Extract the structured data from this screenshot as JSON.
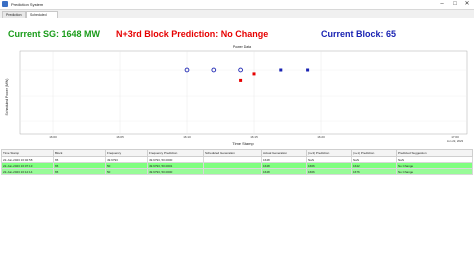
{
  "window": {
    "title": "Prediction System",
    "minimize": "–",
    "maximize": "□",
    "close": "✕"
  },
  "tabs": [
    {
      "label": "Prediction"
    },
    {
      "label": "Scheduled Power"
    }
  ],
  "header": {
    "current_sg": "Current SG: 1648 MW",
    "prediction": "N+3rd Block Prediction: No Change",
    "current_block": "Current Block: 65",
    "colors": {
      "current_sg": "#1a9c1a",
      "prediction": "#e60000",
      "current_block": "#1a23b3"
    }
  },
  "chart_data": {
    "type": "scatter",
    "title": "Power Data",
    "xlabel": "Time Stamp",
    "ylabel": "Scheduled Power (MW)",
    "x_ticks": [
      "16:00",
      "16:05",
      "16:10",
      "16:15",
      "16:20"
    ],
    "x_tick_last": "17:00",
    "x_tick_last_date": "Jun 22, 2023",
    "grid": true,
    "series": [
      {
        "marker": "open-circle",
        "color": "#1a23b3",
        "points": [
          {
            "x": "16:10",
            "y": 1648
          },
          {
            "x": "16:12",
            "y": 1648
          },
          {
            "x": "16:14",
            "y": 1648
          }
        ]
      },
      {
        "marker": "filled-square",
        "color": "#e60000",
        "points": [
          {
            "x": "16:14",
            "y": 1640
          },
          {
            "x": "16:15",
            "y": 1645
          }
        ]
      },
      {
        "marker": "filled-square",
        "color": "#1a23b3",
        "points": [
          {
            "x": "16:17",
            "y": 1648
          },
          {
            "x": "16:19",
            "y": 1648
          }
        ]
      }
    ]
  },
  "table": {
    "columns": [
      "Time Stamp",
      "Block",
      "Frequency",
      "Frequency Prediction",
      "Scheduled Generation",
      "Actual Generation",
      "(n+3) Prediction",
      "(n+1) Prediction",
      "Predicted Suggestion"
    ],
    "rows": [
      {
        "cells": [
          "22-Jun-2023 16:02:58",
          "65",
          "49.9793",
          "49.9793, 50.0000",
          "",
          "1648",
          "NaN",
          "NaN",
          "NaN"
        ],
        "style": "plain"
      },
      {
        "cells": [
          "22-Jun-2023 16:07:13",
          "65",
          "50",
          "49.9793, 50.0001",
          "",
          "1648",
          "1666",
          "1642",
          "No Change"
        ],
        "style": "sel"
      },
      {
        "cells": [
          "22-Jun-2023 16:12:14",
          "65",
          "50",
          "49.9793, 50.0000",
          "",
          "1648",
          "1666",
          "1676",
          "No Change"
        ],
        "style": "sel2"
      }
    ]
  }
}
